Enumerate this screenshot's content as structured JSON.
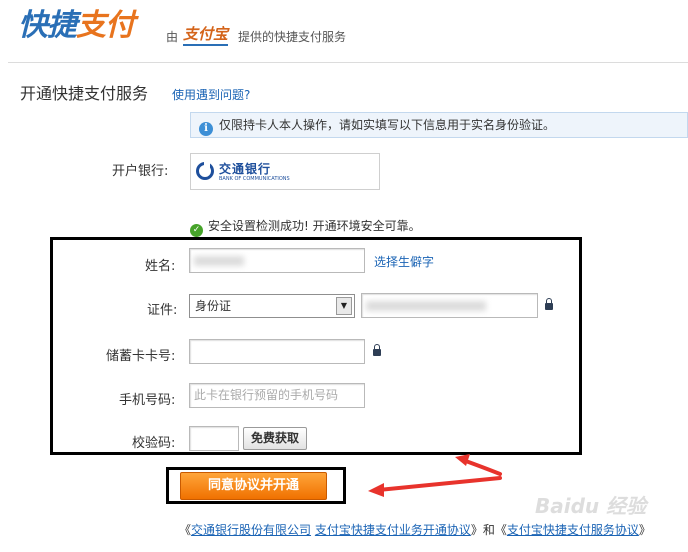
{
  "header": {
    "logo_part1": "快捷",
    "logo_part2": "支付",
    "by_text": "由",
    "alipay_logo_text": "支付宝",
    "provided_text": "提供的快捷支付服务"
  },
  "page": {
    "title": "开通快捷支付服务",
    "help_link": "使用遇到问题?"
  },
  "notice": {
    "icon": "info-icon",
    "text": "仅限持卡人本人操作，请如实填写以下信息用于实名身份验证。"
  },
  "bank": {
    "label": "开户银行:",
    "name": "交通银行",
    "name_en": "BANK OF COMMUNICATIONS"
  },
  "security": {
    "icon": "check-circle-icon",
    "text": "安全设置检测成功! 开通环境安全可靠。"
  },
  "form": {
    "name_label": "姓名:",
    "rare_char_link": "选择生僻字",
    "id_label": "证件:",
    "id_type_selected": "身份证",
    "card_label": "储蓄卡卡号:",
    "card_value": "",
    "phone_label": "手机号码:",
    "phone_placeholder": "此卡在银行预留的手机号码",
    "code_label": "校验码:",
    "code_value": "",
    "code_button": "免费获取"
  },
  "actions": {
    "submit_button": "同意协议并开通"
  },
  "agreements": {
    "prefix": "《",
    "link1": "交通银行股份有限公司",
    "link2": "支付宝快捷支付业务开通协议",
    "mid": "》和《",
    "link3": "支付宝快捷支付服务协议",
    "suffix": "》"
  },
  "watermark": {
    "text": "Baidu 经验"
  },
  "colors": {
    "brand_blue": "#2a6fb6",
    "brand_orange": "#e8741e",
    "link_blue": "#1b64b5",
    "submit_orange": "#f07100",
    "annotation_red": "#e8332c"
  }
}
